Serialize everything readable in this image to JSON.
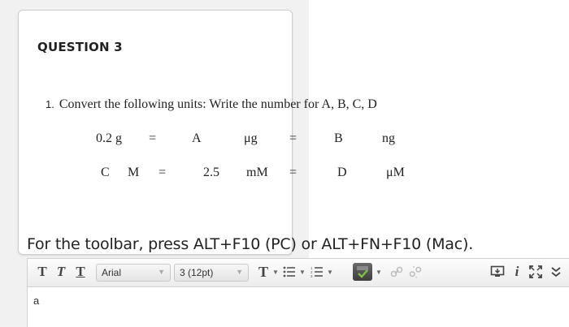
{
  "question": {
    "title": "QUESTION 3",
    "number": "1.",
    "prompt": "Convert the following units:  Write the number for A, B, C, D",
    "rows": [
      [
        "0.2 g",
        "=",
        "A",
        "μg",
        "=",
        "B",
        "ng"
      ],
      [
        "C",
        "M",
        "=",
        "2.5",
        "mM",
        "=",
        "D",
        "μM"
      ]
    ]
  },
  "toolbar_instructions": "For the toolbar, press ALT+F10 (PC) or ALT+FN+F10 (Mac).",
  "editor": {
    "font_family_value": "Arial",
    "font_size_value": "3 (12pt)",
    "content": "a",
    "icons": [
      "bold-t-icon",
      "italic-t-icon",
      "underline-t-icon",
      "text-color-icon",
      "bullet-list-icon",
      "numbered-list-icon",
      "spellcheck-icon",
      "link-icon",
      "unlink-icon",
      "preview-icon",
      "info-icon",
      "fullscreen-icon",
      "collapse-icon"
    ]
  },
  "colors": {
    "card_border": "#cfcfcf",
    "toolbar_bg": "#ececec",
    "spellcheck_bg": "#4a4a4a",
    "check_green": "#7ec242"
  }
}
